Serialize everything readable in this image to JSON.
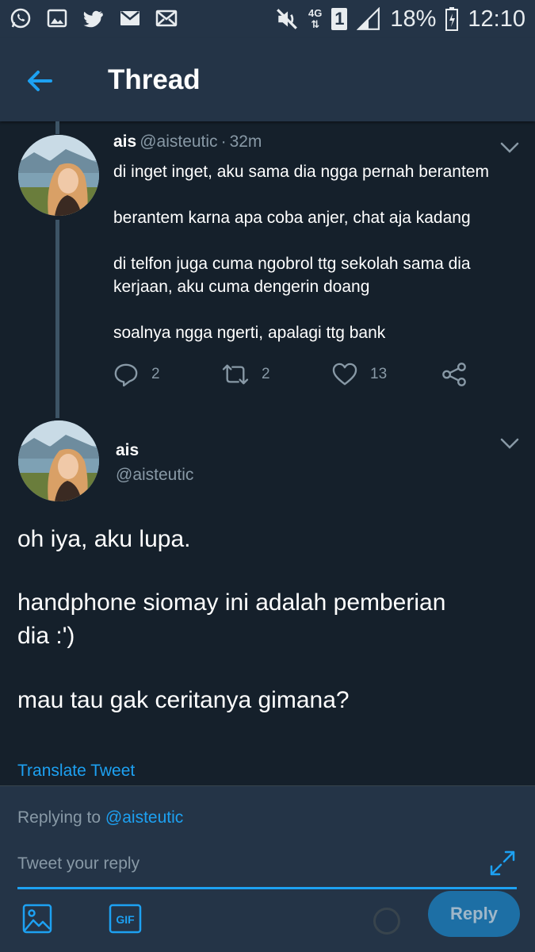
{
  "status_bar": {
    "network": "4G",
    "sim_slot": "1",
    "battery": "18%",
    "time": "12:10",
    "left_icons": [
      "whatsapp-icon",
      "gallery-icon",
      "twitter-icon",
      "email-icon",
      "mail-icon"
    ],
    "right_icons": [
      "mute-icon",
      "sim-icon",
      "signal-icon",
      "battery-icon"
    ]
  },
  "header": {
    "title": "Thread",
    "back_icon": "back-arrow-icon"
  },
  "tweet1": {
    "name": "ais",
    "handle": "@aisteutic",
    "separator": "·",
    "time": "32m",
    "lines": [
      "di inget inget, aku sama dia ngga pernah berantem",
      "berantem karna apa coba anjer, chat aja kadang",
      "di telfon juga cuma ngobrol ttg sekolah sama dia",
      "kerjaan, aku cuma dengerin doang",
      "soalnya ngga ngerti, apalagi ttg bank"
    ],
    "replies": "2",
    "retweets": "2",
    "likes": "13"
  },
  "tweet2": {
    "name": "ais",
    "handle": "@aisteutic",
    "lines": [
      "oh iya, aku lupa.",
      "handphone siomay ini adalah pemberian",
      "dia :')",
      "mau tau gak ceritanya gimana?"
    ],
    "translate": "Translate Tweet"
  },
  "reply": {
    "replying_prefix": "Replying to",
    "replying_handle": "@aisteutic",
    "placeholder": "Tweet your reply",
    "gif_label": "GIF",
    "button": "Reply"
  },
  "colors": {
    "background": "#15202b",
    "bars": "#243447",
    "accent": "#1da1f2",
    "muted": "#8899a6"
  }
}
